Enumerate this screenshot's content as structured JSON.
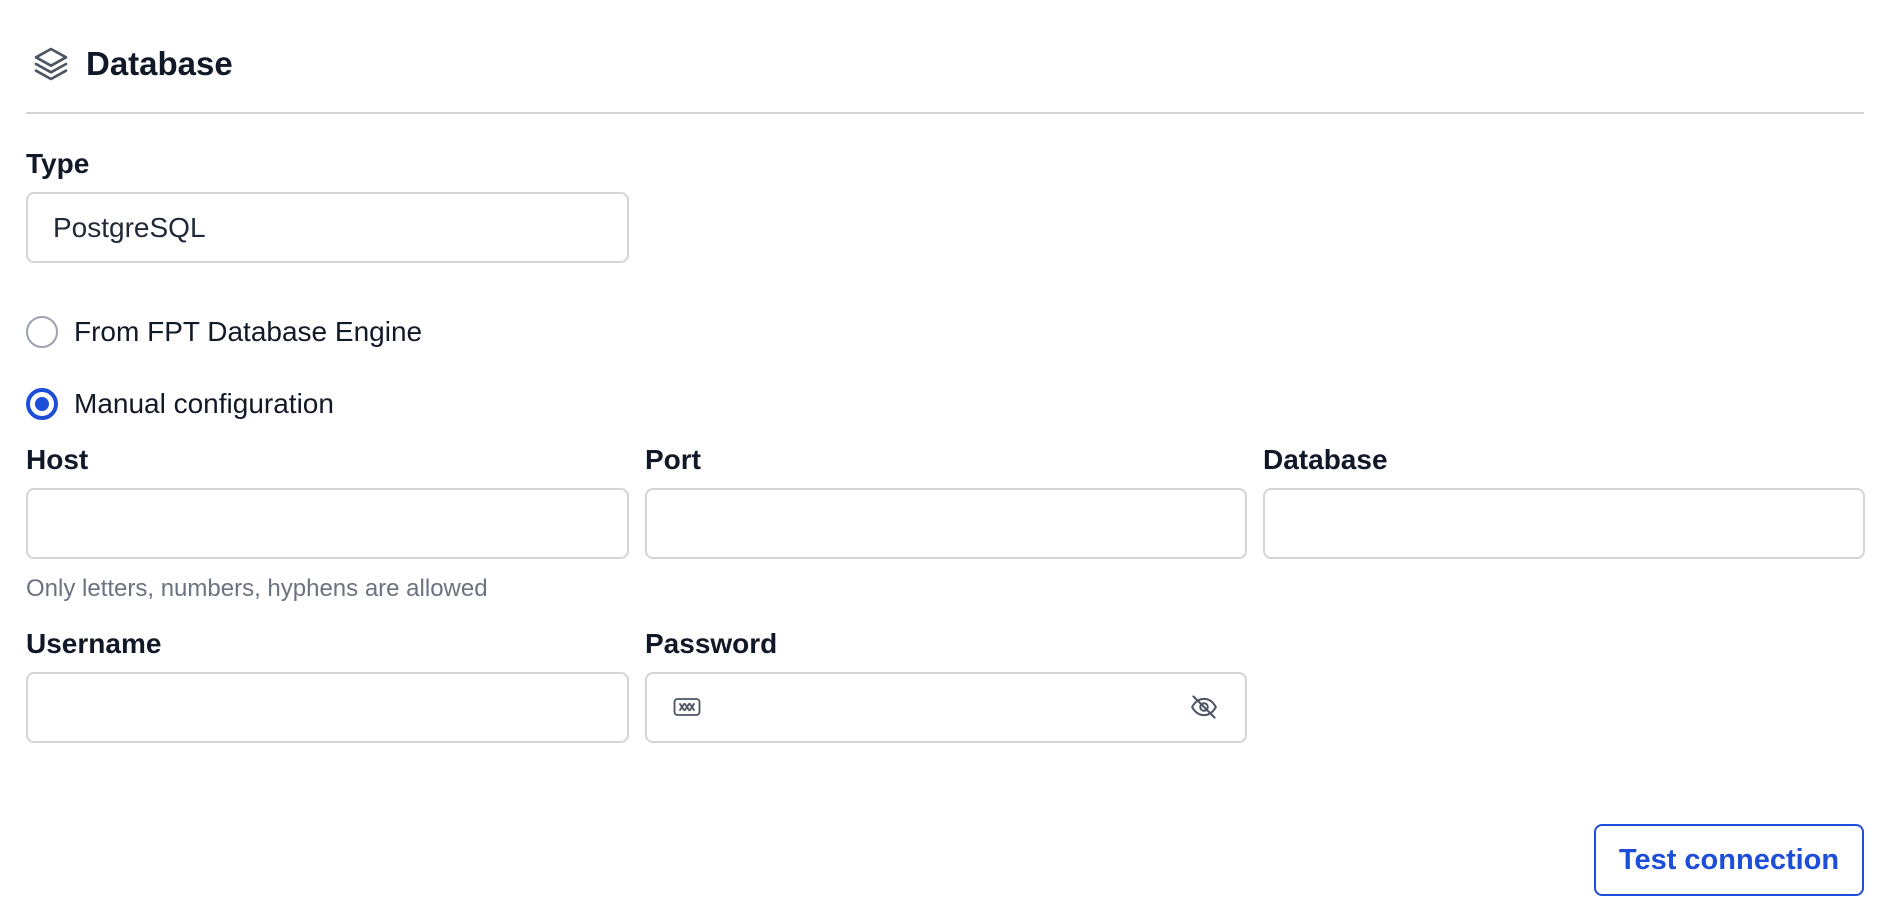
{
  "section": {
    "title": "Database",
    "icon": "layers-icon"
  },
  "type": {
    "label": "Type",
    "value": "PostgreSQL"
  },
  "source_options": [
    {
      "label": "From FPT Database Engine",
      "selected": false
    },
    {
      "label": "Manual configuration",
      "selected": true
    }
  ],
  "connection": {
    "host": {
      "label": "Host",
      "value": "",
      "hint": "Only letters, numbers, hyphens are allowed"
    },
    "port": {
      "label": "Port",
      "value": ""
    },
    "database": {
      "label": "Database",
      "value": ""
    },
    "username": {
      "label": "Username",
      "value": ""
    },
    "password": {
      "label": "Password",
      "value": "",
      "leading_icon": "password-icon",
      "toggle_icon": "eye-off-icon"
    }
  },
  "actions": {
    "test_connection": "Test connection"
  },
  "colors": {
    "accent": "#1d4ed8",
    "border": "#d4d4d8",
    "hint_text": "#6b7280"
  }
}
